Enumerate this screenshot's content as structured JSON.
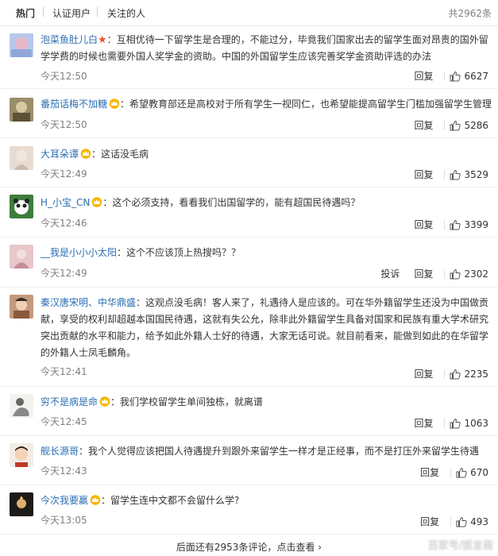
{
  "tabs": [
    "热门",
    "认证用户",
    "关注的人"
  ],
  "total": "共2962条",
  "labels": {
    "reply": "回复",
    "report": "投诉"
  },
  "comments": [
    {
      "user": "泡菜鱼肚儿白",
      "badge": "star",
      "text": "互相优待一下留学生是合理的，不能过分，毕竟我们国家出去的留学生面对昂贵的国外留学学费的时候也需要外国人奖学金的资助。中国的外国留学生应该完善奖学金资助评选的办法",
      "time": "今天12:50",
      "likes": "6627"
    },
    {
      "user": "番茄话梅不加糖",
      "badge": "crown",
      "text": "希望教育部还是高校对于所有学生一视同仁，也希望能提高留学生门槛加强留学生管理",
      "time": "今天12:50",
      "likes": "5286"
    },
    {
      "user": "大耳朵谭",
      "badge": "crown",
      "text": "这话没毛病",
      "time": "今天12:49",
      "likes": "3529"
    },
    {
      "user": "H_小宝_CN",
      "badge": "crown",
      "text": "这个必须支持，看看我们出国留学的，能有超国民待遇吗？",
      "time": "今天12:46",
      "likes": "3399"
    },
    {
      "user": "__我是小小小太阳",
      "badge": "",
      "text": "这个不应该顶上热搜吗？？",
      "time": "今天12:49",
      "likes": "2302"
    },
    {
      "user": "秦汉唐宋明、中华鼎盛",
      "badge": "",
      "text": "这观点没毛病！客人来了，礼遇待人是应该的。可在华外籍留学生还没为中国做贡献，享受的权利却超越本国国民待遇，这就有失公允，除非此外籍留学生具备对国家和民族有重大学术研究突出贡献的水平和能力，给予如此外籍人士好的待遇，大家无话可说。就目前看来，能做到如此的在华留学的外籍人士凤毛麟角。",
      "time": "今天12:41",
      "likes": "2235"
    },
    {
      "user": "穷不是病是命",
      "badge": "crown",
      "text": "我们学校留学生单间独栋，就离谱",
      "time": "今天12:45",
      "likes": "1063"
    },
    {
      "user": "舰长源哥",
      "badge": "",
      "text": "我个人觉得应该把国人待遇提升到跟外来留学生一样才是正经事，而不是打压外来留学生待遇",
      "time": "今天12:43",
      "likes": "670"
    },
    {
      "user": "今次我要赢",
      "badge": "crown",
      "text": "留学生连中文都不会留什么学?",
      "time": "今天13:05",
      "likes": "493"
    }
  ],
  "footer": "后面还有2953条评论，点击查看",
  "footer_arrow": "›",
  "watermark": "百家号/狐言斋"
}
